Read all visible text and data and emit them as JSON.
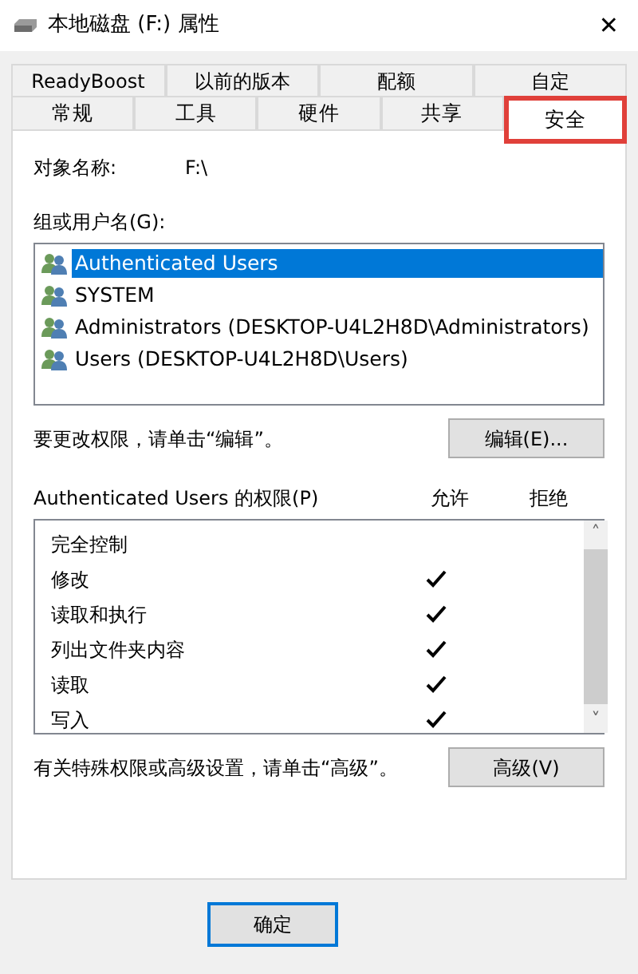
{
  "window": {
    "title": "本地磁盘 (F:) 属性",
    "close": "✕"
  },
  "tabs_back": [
    {
      "label": "ReadyBoost",
      "selected": false
    },
    {
      "label": "以前的版本",
      "selected": false
    },
    {
      "label": "配额",
      "selected": false
    },
    {
      "label": "自定",
      "selected": false
    }
  ],
  "tabs_front": [
    {
      "label": "常规",
      "selected": false,
      "highlighted": false
    },
    {
      "label": "工具",
      "selected": false,
      "highlighted": false
    },
    {
      "label": "硬件",
      "selected": false,
      "highlighted": false
    },
    {
      "label": "共享",
      "selected": false,
      "highlighted": false
    },
    {
      "label": "安全",
      "selected": true,
      "highlighted": true
    }
  ],
  "object": {
    "label": "对象名称:",
    "value": "F:\\"
  },
  "groups": {
    "label": "组或用户名(G):",
    "items": [
      {
        "name": "Authenticated Users",
        "selected": true
      },
      {
        "name": "SYSTEM",
        "selected": false
      },
      {
        "name": "Administrators (DESKTOP-U4L2H8D\\Administrators)",
        "selected": false
      },
      {
        "name": "Users (DESKTOP-U4L2H8D\\Users)",
        "selected": false
      }
    ]
  },
  "edit": {
    "hint": "要更改权限，请单击“编辑”。",
    "button": "编辑(E)..."
  },
  "permissions": {
    "label": "Authenticated Users 的权限(P)",
    "allow_header": "允许",
    "deny_header": "拒绝",
    "rows": [
      {
        "name": "完全控制",
        "allow": false
      },
      {
        "name": "修改",
        "allow": true
      },
      {
        "name": "读取和执行",
        "allow": true
      },
      {
        "name": "列出文件夹内容",
        "allow": true
      },
      {
        "name": "读取",
        "allow": true
      },
      {
        "name": "写入",
        "allow": true
      }
    ],
    "scroll_up": "˄",
    "scroll_down": "˅"
  },
  "advanced": {
    "hint": "有关特殊权限或高级设置，请单击“高级”。",
    "button": "高级(V)"
  },
  "buttons": [
    {
      "label": "确定"
    }
  ]
}
